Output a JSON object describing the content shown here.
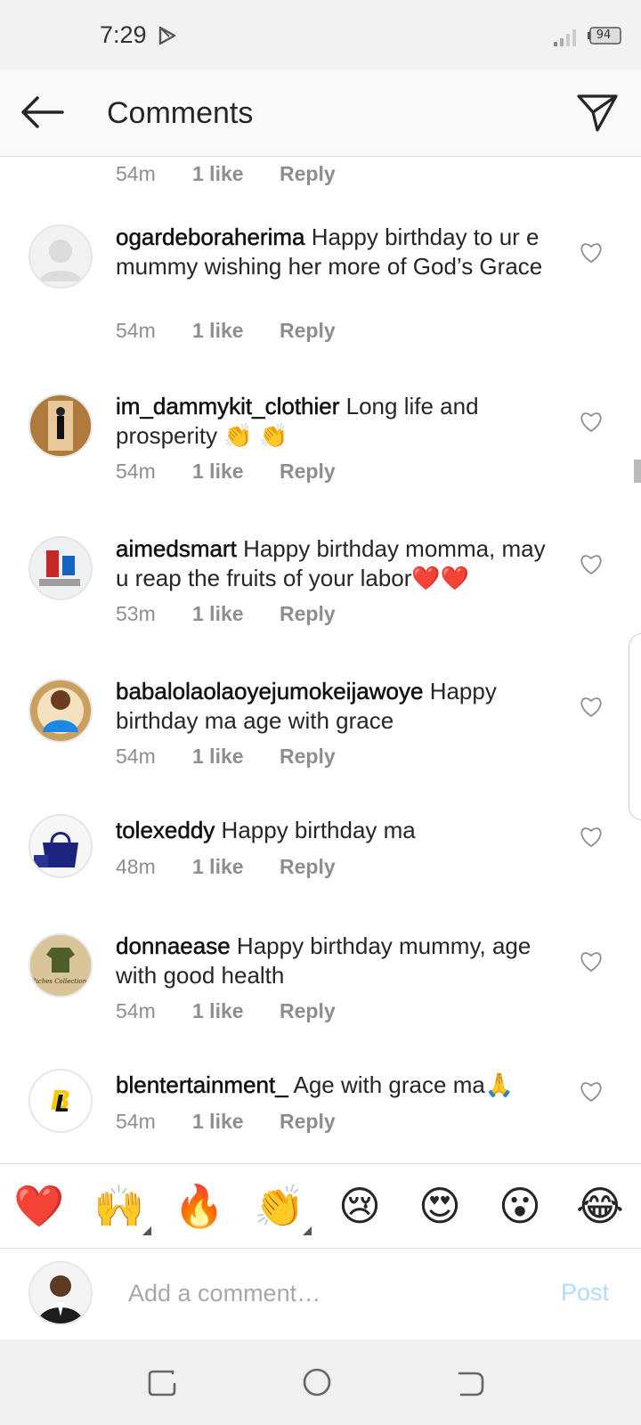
{
  "status_bar": {
    "time": "7:29",
    "battery": "94"
  },
  "header": {
    "title": "Comments"
  },
  "top_partial": {
    "time": "54m",
    "likes": "1 like",
    "reply": "Reply"
  },
  "comments": [
    {
      "username": "ogardeboraherima",
      "text": "Happy birthday to ur e mummy wishing her more of God’s Grace",
      "time": "54m",
      "likes": "1 like",
      "reply": "Reply"
    },
    {
      "username": "im_dammykit_clothier",
      "text": "Long life and prosperity 👏 👏",
      "time": "54m",
      "likes": "1 like",
      "reply": "Reply"
    },
    {
      "username": "aimedsmart",
      "text": "Happy birthday momma, may u reap the fruits of your labor❤️❤️",
      "time": "53m",
      "likes": "1 like",
      "reply": "Reply"
    },
    {
      "username": "babalolaolaoyejumokeijawoye",
      "text": "Happy birthday ma age with grace",
      "time": "54m",
      "likes": "1 like",
      "reply": "Reply"
    },
    {
      "username": "tolexeddy",
      "text": "Happy birthday ma",
      "time": "48m",
      "likes": "1 like",
      "reply": "Reply"
    },
    {
      "username": "donnaease",
      "text": "Happy birthday mummy, age with good health",
      "time": "54m",
      "likes": "1 like",
      "reply": "Reply"
    },
    {
      "username": "blentertainment_",
      "text": "Age with grace ma🙏",
      "time": "54m",
      "likes": "1 like",
      "reply": "Reply"
    }
  ],
  "emoji_bar": [
    "❤️",
    "🙌",
    "🔥",
    "👏",
    "😢",
    "😍",
    "😮",
    "😂"
  ],
  "input": {
    "placeholder": "Add a comment…",
    "post_label": "Post"
  }
}
